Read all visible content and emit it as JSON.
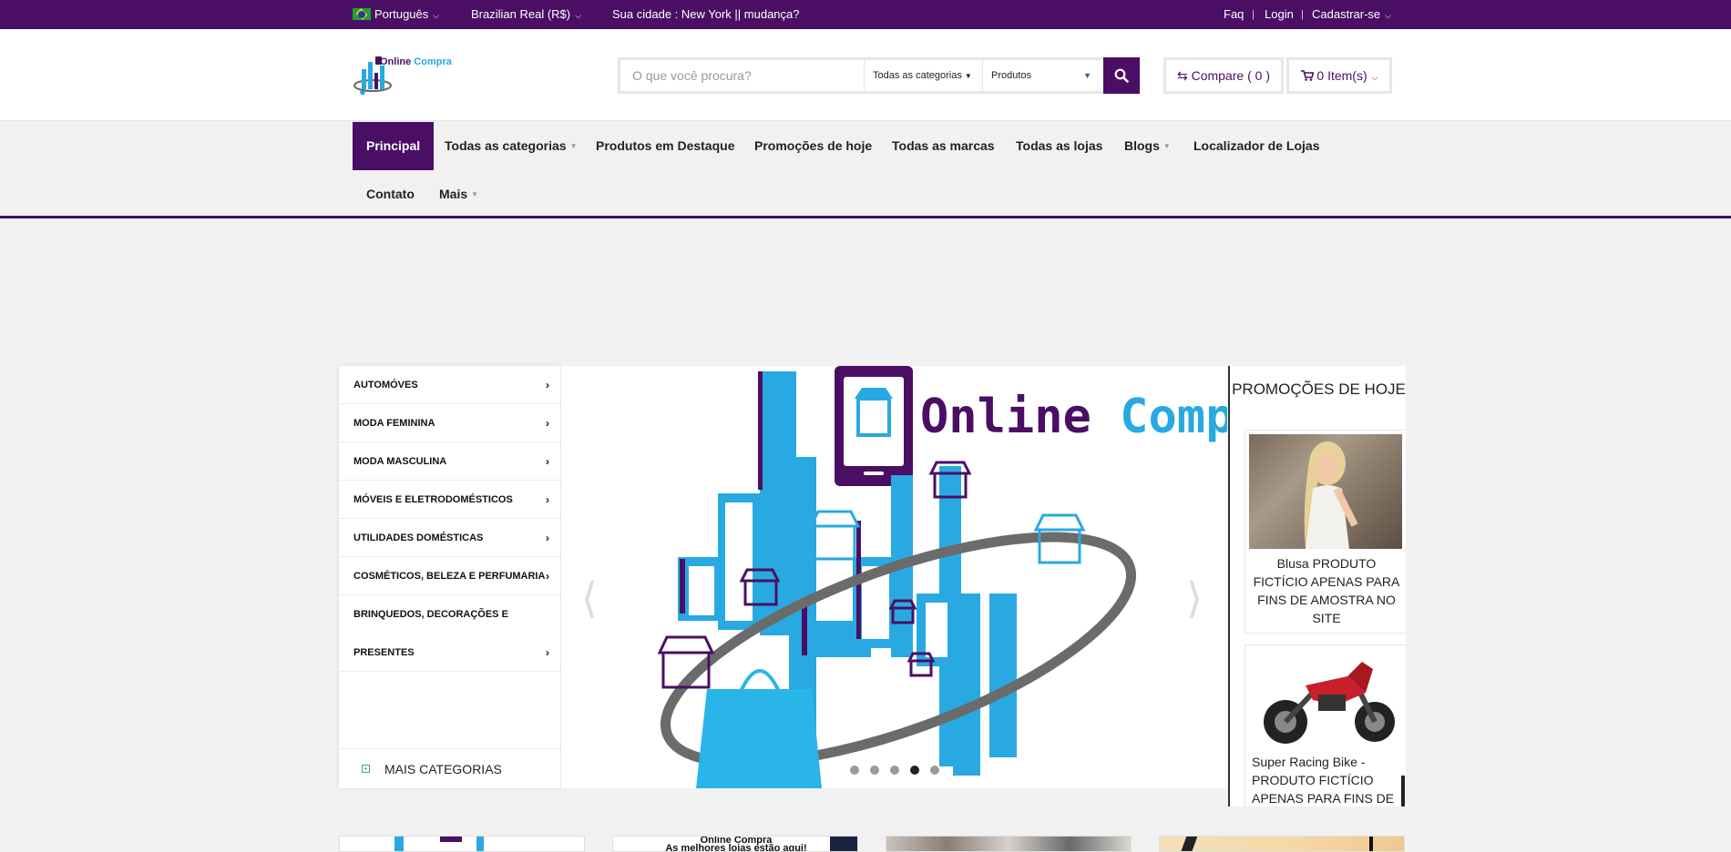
{
  "topbar": {
    "language": "Português",
    "currency": "Brazilian Real (R$)",
    "city": "Sua cidade : New York || mudança?",
    "faq": "Faq",
    "login": "Login",
    "register": "Cadastrar-se"
  },
  "logo": {
    "part1": "Online",
    "part2": "Compra"
  },
  "search": {
    "placeholder": "O que você procura?",
    "category": "Todas as categorias",
    "type": "Produtos"
  },
  "compare": {
    "label": "Compare ( 0 )"
  },
  "cart": {
    "label": "0 Item(s)"
  },
  "nav": {
    "items": [
      {
        "label": "Principal"
      },
      {
        "label": "Todas as categorias"
      },
      {
        "label": "Produtos em Destaque"
      },
      {
        "label": "Promoções de hoje"
      },
      {
        "label": "Todas as marcas"
      },
      {
        "label": "Todas as lojas"
      },
      {
        "label": "Blogs"
      },
      {
        "label": "Localizador de Lojas"
      },
      {
        "label": "Contato"
      },
      {
        "label": "Mais"
      }
    ]
  },
  "categories": {
    "items": [
      {
        "label": "AUTOMÓVES"
      },
      {
        "label": "MODA FEMININA"
      },
      {
        "label": "MODA MASCULINA"
      },
      {
        "label": "MÓVEIS E ELETRODOMÉSTICOS"
      },
      {
        "label": "UTILIDADES DOMÉSTICAS"
      },
      {
        "label": "COSMÉTICOS, BELEZA E PERFUMARIA"
      },
      {
        "label": "BRINQUEDOS, DECORAÇÕES E"
      },
      {
        "label": "PRESENTES"
      }
    ],
    "more": "MAIS CATEGORIAS"
  },
  "slider": {
    "brand_part1": "Online",
    "brand_part2": "Compra",
    "active_slide": 4,
    "slide_count": 5
  },
  "promos": {
    "title": "PROMOÇÕES DE HOJE",
    "products": [
      {
        "name": "Blusa PRODUTO FICTÍCIO APENAS PARA FINS DE AMOSTRA NO SITE"
      },
      {
        "name": "Super Racing Bike - PRODUTO FICTÍCIO APENAS PARA FINS DE"
      }
    ]
  },
  "banners": {
    "text1": "Online Compra",
    "text2": "As melhores lojas estão aqui!"
  },
  "colors": {
    "brand": "#4a0f64",
    "accent": "#29a9e1"
  }
}
